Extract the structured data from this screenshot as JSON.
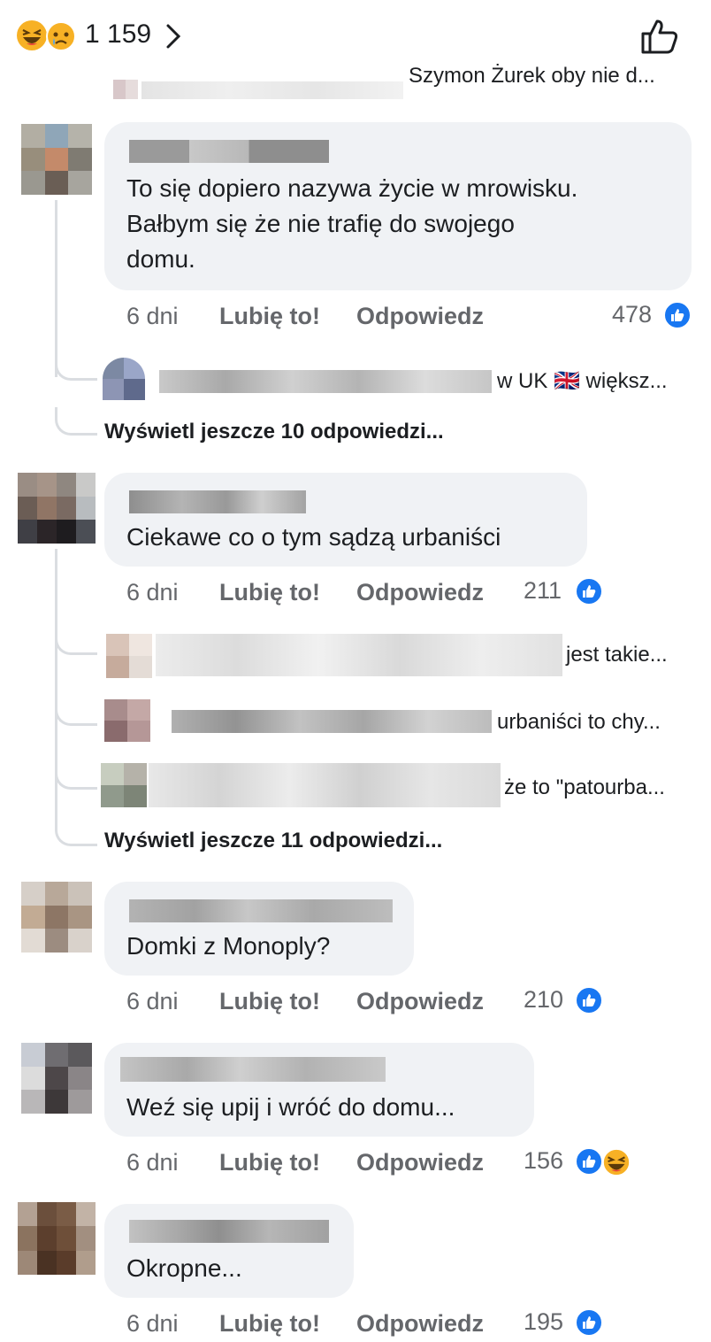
{
  "header": {
    "reaction_count": "1 159",
    "chevron": "›",
    "icons": [
      "haha-emoji-icon",
      "sad-emoji-icon",
      "chevron-right-icon",
      "thumbs-up-outline-icon"
    ]
  },
  "partial_top_comment": {
    "text": "Szymon Żurek oby nie d..."
  },
  "comments": [
    {
      "text_lines": [
        "To się dopiero nazywa życie w mrowisku.",
        "Bałbym się że nie trafię do swojego",
        "domu."
      ],
      "time": "6 dni",
      "like": "Lubię to!",
      "reply": "Odpowiedz",
      "reactions": "478",
      "reaction_icons": [
        "like-icon"
      ],
      "replies": [
        {
          "preview": "w UK 🇬🇧 większ..."
        }
      ],
      "more_replies": "Wyświetl jeszcze 10 odpowiedzi..."
    },
    {
      "text_lines": [
        "Ciekawe co o tym sądzą urbaniści"
      ],
      "time": "6 dni",
      "like": "Lubię to!",
      "reply": "Odpowiedz",
      "reactions": "211",
      "reaction_icons": [
        "like-icon"
      ],
      "replies": [
        {
          "preview": "jest takie..."
        },
        {
          "preview": "urbaniści to chy..."
        },
        {
          "preview": "że to \"patourba..."
        }
      ],
      "more_replies": "Wyświetl jeszcze 11 odpowiedzi..."
    },
    {
      "text_lines": [
        "Domki z Monoply?"
      ],
      "time": "6 dni",
      "like": "Lubię to!",
      "reply": "Odpowiedz",
      "reactions": "210",
      "reaction_icons": [
        "like-icon"
      ]
    },
    {
      "text_lines": [
        "Weź się upij i wróć do domu..."
      ],
      "time": "6 dni",
      "like": "Lubię to!",
      "reply": "Odpowiedz",
      "reactions": "156",
      "reaction_icons": [
        "like-icon",
        "haha-icon"
      ]
    },
    {
      "text_lines": [
        "Okropne..."
      ],
      "time": "6 dni",
      "like": "Lubię to!",
      "reply": "Odpowiedz",
      "reactions": "195",
      "reaction_icons": [
        "like-icon"
      ]
    }
  ],
  "colors": {
    "like_blue": "#1877f2",
    "bubble_bg": "#f0f2f5",
    "meta_grey": "#65676b",
    "haha_yellow": "#f7b125"
  }
}
